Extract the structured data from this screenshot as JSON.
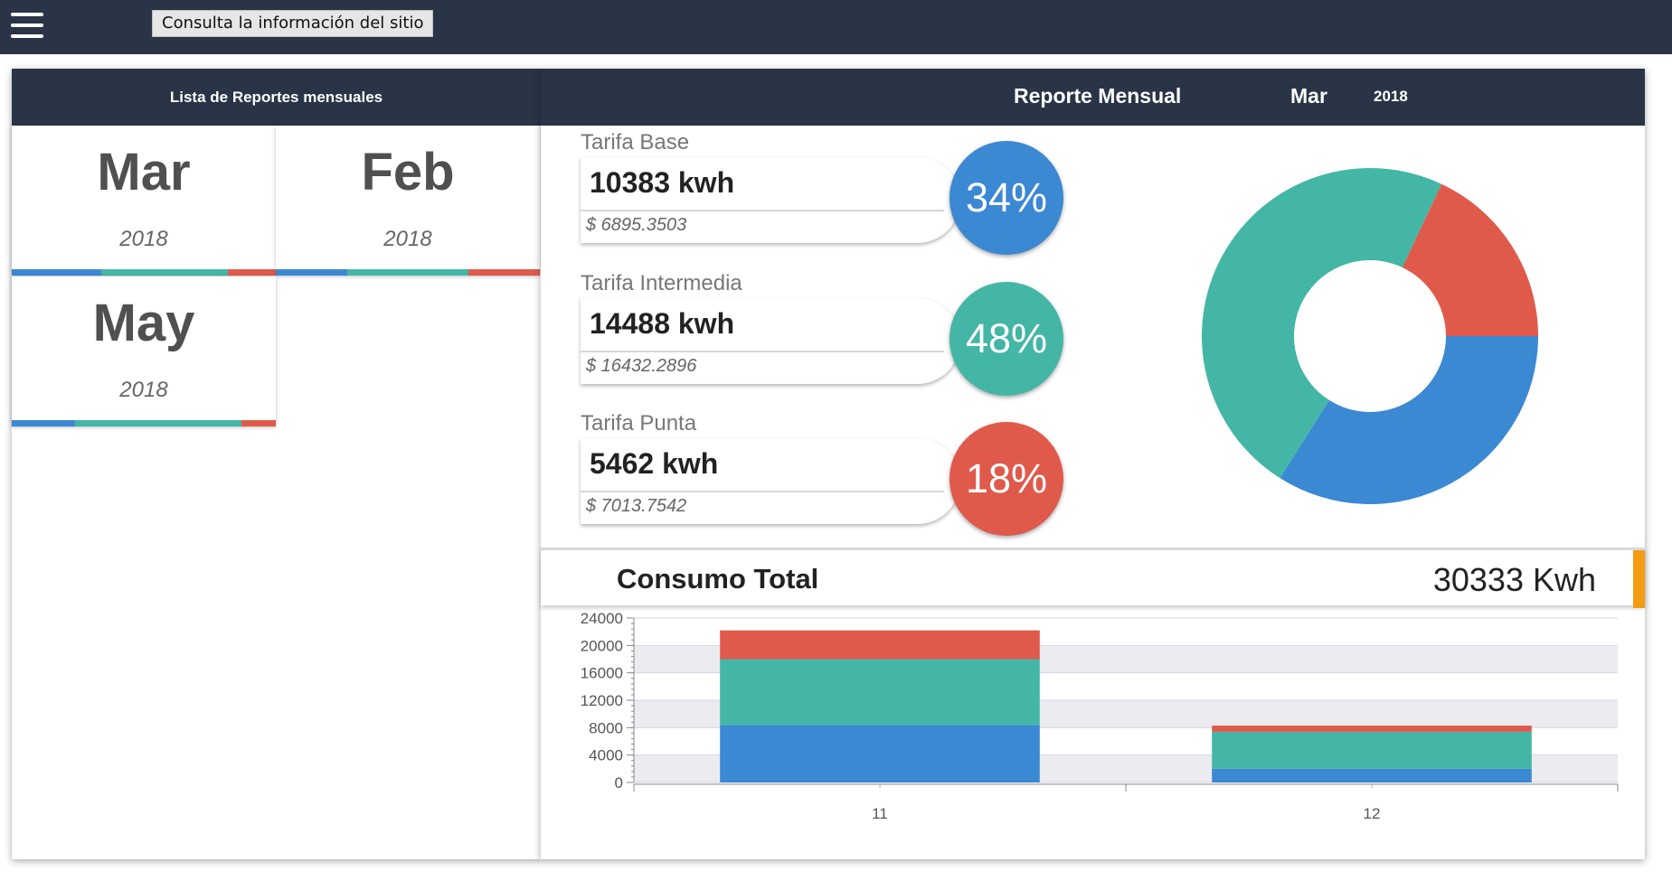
{
  "topbar": {
    "tooltip": "Consulta la información del sitio"
  },
  "left_panel": {
    "title": "Lista de Reportes mensuales",
    "cards": [
      {
        "month": "Mar",
        "year": "2018",
        "bar": [
          34,
          48,
          18
        ]
      },
      {
        "month": "Feb",
        "year": "2018",
        "bar": [
          27,
          46,
          27
        ]
      },
      {
        "month": "May",
        "year": "2018",
        "bar": [
          24,
          63,
          13
        ]
      }
    ]
  },
  "right_panel": {
    "title": "Reporte Mensual",
    "month": "Mar",
    "year": "2018",
    "tarifas": [
      {
        "label": "Tarifa Base",
        "kwh": "10383 kwh",
        "cost": "$ 6895.3503",
        "percent": "34%",
        "color": "#3b88d3"
      },
      {
        "label": "Tarifa Intermedia",
        "kwh": "14488 kwh",
        "cost": "$ 16432.2896",
        "percent": "48%",
        "color": "#44b6a6"
      },
      {
        "label": "Tarifa Punta",
        "kwh": "5462 kwh",
        "cost": "$ 7013.7542",
        "percent": "18%",
        "color": "#e05a4c"
      }
    ],
    "consumo_label": "Consumo Total",
    "consumo_value": "30333 Kwh"
  },
  "colors": {
    "base": "#3b88d3",
    "intermedia": "#44b6a6",
    "punta": "#e05a4c",
    "header": "#2a3447",
    "accent": "#f39c12"
  },
  "chart_data": [
    {
      "type": "pie",
      "labels": [],
      "values": [
        34,
        48,
        18
      ],
      "colors": [
        "#3b88d3",
        "#44b6a6",
        "#e05a4c"
      ],
      "donut": true
    },
    {
      "type": "bar",
      "stacked": true,
      "categories": [
        "11",
        "12"
      ],
      "series": [
        {
          "values": [
            8400,
            2000
          ],
          "color": "#3b88d3"
        },
        {
          "values": [
            9600,
            5400
          ],
          "color": "#44b6a6"
        },
        {
          "values": [
            4200,
            900
          ],
          "color": "#e05a4c"
        }
      ],
      "ylim": [
        0,
        24000
      ],
      "yticks": [
        "24000",
        "20000",
        "16000",
        "12000",
        "8000",
        "4000",
        "0"
      ],
      "grid": true
    }
  ]
}
